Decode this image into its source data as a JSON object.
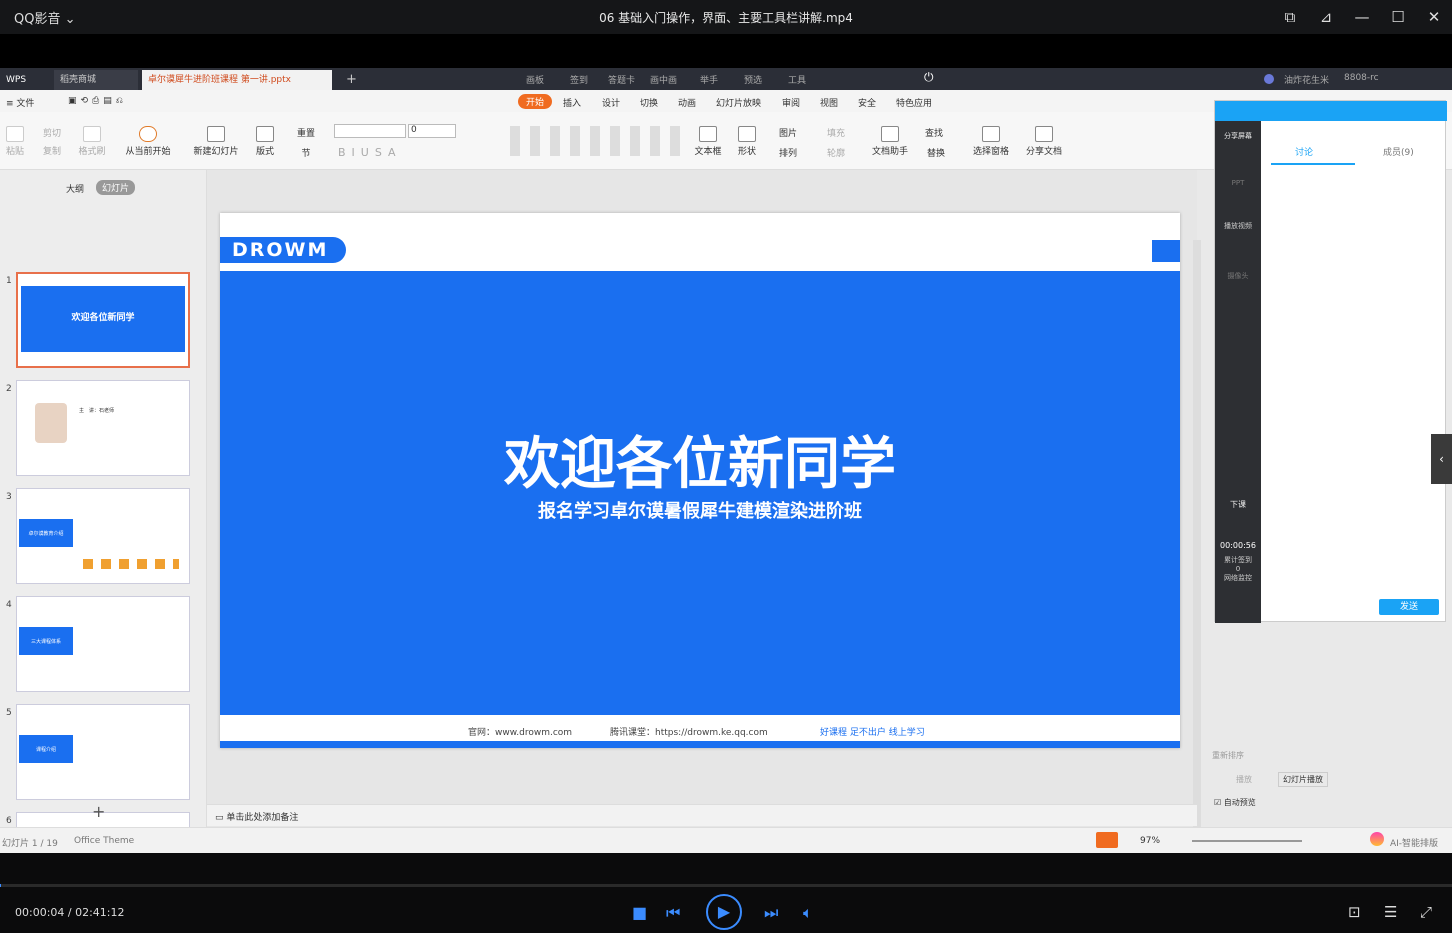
{
  "titlebar": {
    "app_name": "QQ影音",
    "app_chevron": "⌄",
    "file_title": "06 基础入门操作，界面、主要工具栏讲解.mp4"
  },
  "wps": {
    "tabs": [
      "WPS",
      "稻壳商城",
      "卓尔谟犀牛进阶班课程 第一讲.pptx"
    ],
    "add_tab": "+",
    "menus": [
      "画板",
      "签到",
      "答题卡",
      "画中画",
      "举手",
      "预选",
      "工具"
    ],
    "user": "油炸花生米",
    "room": "8808-rc"
  },
  "ribbon": {
    "file_menu": "文件",
    "tabs": [
      "开始",
      "插入",
      "设计",
      "切换",
      "动画",
      "幻灯片放映",
      "审阅",
      "视图",
      "安全",
      "特色应用"
    ],
    "buttons": [
      "粘贴",
      "剪切",
      "复制",
      "格式刷",
      "从当前开始",
      "新建幻灯片",
      "版式",
      "重置",
      "节",
      "文本框",
      "形状",
      "图片",
      "排列",
      "填充",
      "轮廓",
      "文档助手",
      "查找",
      "替换",
      "选择窗格",
      "分享文档"
    ],
    "font_size": "0"
  },
  "leftpane": {
    "view_tabs": [
      "大纲",
      "幻灯片"
    ],
    "slide_numbers": [
      "1",
      "2",
      "3",
      "4",
      "5",
      "6"
    ],
    "thumb_titles": [
      "欢迎各位新同学",
      "主　讲：石老师",
      "卓尔谟教育介绍",
      "三大课程体系",
      "课程介绍",
      ""
    ],
    "add": "+"
  },
  "slide": {
    "logo": "DROWM",
    "title": "欢迎各位新同学",
    "subtitle": "报名学习卓尔谟暑假犀牛建模渲染进阶班",
    "footer": [
      "官网：www.drowm.com",
      "腾讯课堂：https://drowm.ke.qq.com",
      "好课程  足不出户  线上学习"
    ],
    "colors": {
      "blue": "#1a6ff0"
    }
  },
  "notes": {
    "placeholder": "单击此处添加备注"
  },
  "status": {
    "slide_count": "幻灯片 1 / 19",
    "theme": "Office Theme",
    "zoom": "97%",
    "ai": "AI-智能排版"
  },
  "qq": {
    "share_screen": "分享屏幕",
    "ppt": "PPT",
    "play_video": "播放视频",
    "camera": "摄像头",
    "end_class": "下课",
    "timer": "00:00:56",
    "accumulated": "累计签到",
    "count": "0",
    "network": "网络监控",
    "tabs": [
      "讨论",
      "成员(9)"
    ],
    "send": "发送",
    "reorder": "重新排序",
    "play": "播放",
    "slide_play": "幻灯片播放",
    "auto_preview": "自动预览"
  },
  "player": {
    "time": "00:00:04 / 02:41:12",
    "progress": 0.0004
  }
}
